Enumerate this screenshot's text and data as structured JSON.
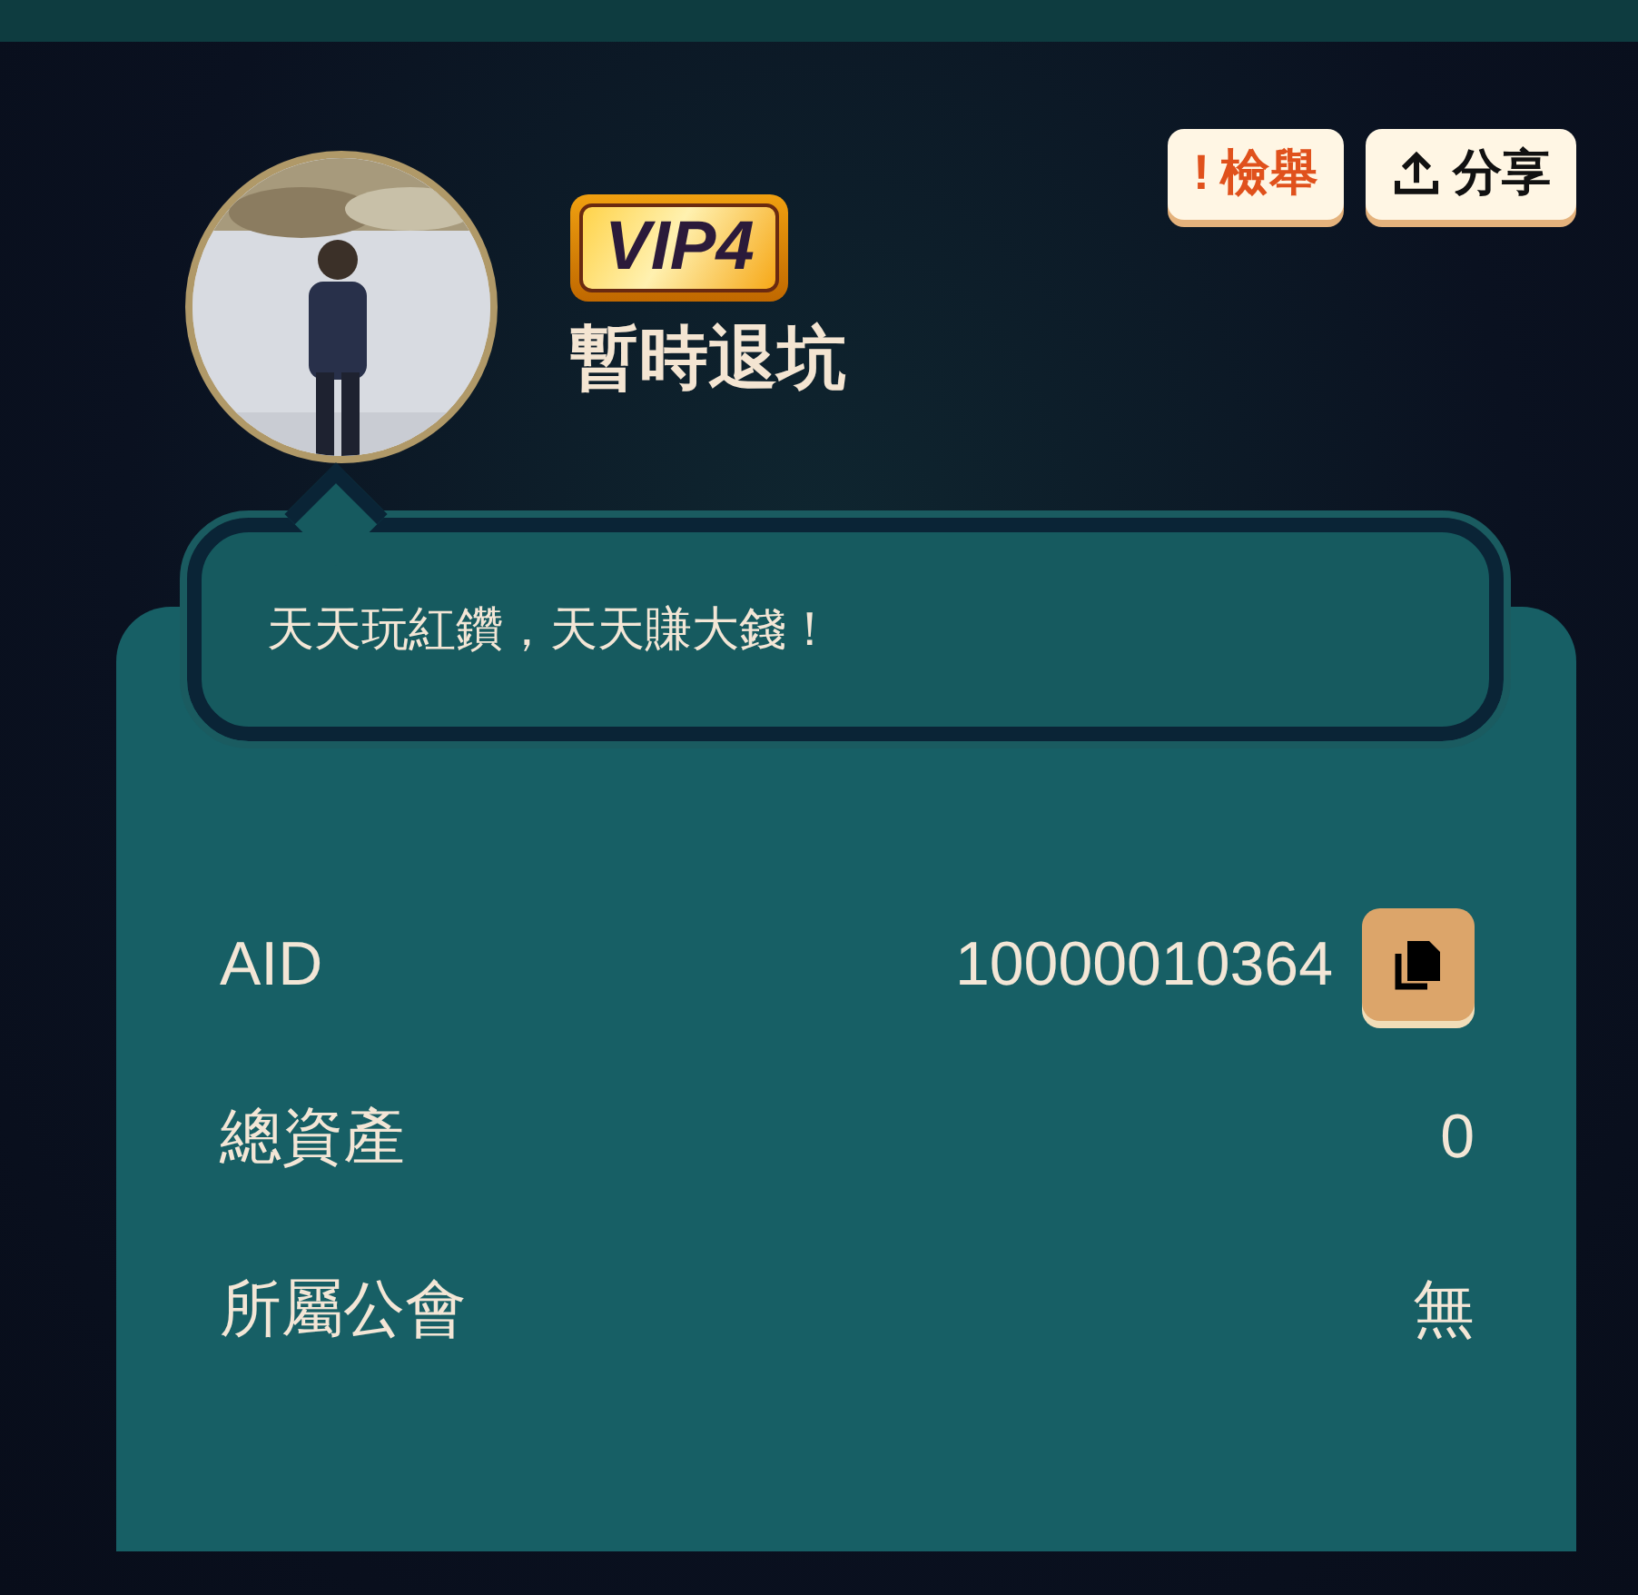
{
  "actions": [
    {
      "kind": "report",
      "icon": "!",
      "label": "檢舉"
    },
    {
      "kind": "share",
      "label": "分享"
    }
  ],
  "profile": {
    "vip": "VIP4",
    "name": "暫時退坑",
    "bio": "天天玩紅鑽，天天賺大錢！"
  },
  "details": [
    {
      "label": "AID",
      "value": "10000010364",
      "copyable": true
    },
    {
      "label": "總資產",
      "value": "0",
      "copyable": false
    },
    {
      "label": "所屬公會",
      "value": "無",
      "copyable": false
    }
  ]
}
